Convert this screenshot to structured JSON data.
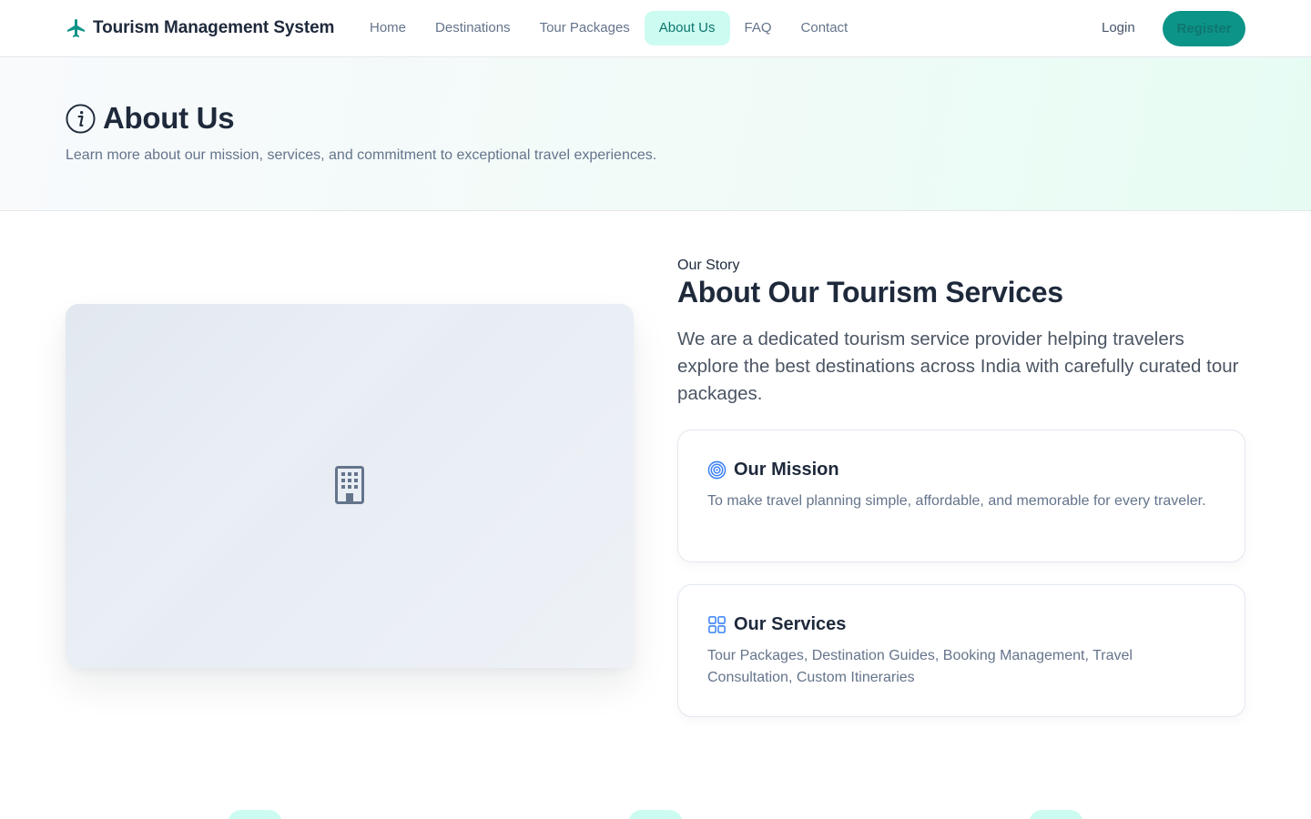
{
  "nav": {
    "brand": "Tourism Management System",
    "brand_icon": "airplane-icon",
    "links": [
      "Home",
      "Destinations",
      "Tour Packages",
      "About Us",
      "FAQ",
      "Contact"
    ],
    "active_link": "About Us",
    "login": "Login",
    "register": "Register"
  },
  "hero": {
    "icon": "info-icon",
    "title": "About Us",
    "subtitle": "Learn more about our mission, services, and commitment to exceptional travel experiences."
  },
  "image": {
    "icon": "building-icon"
  },
  "story": {
    "eyebrow": "Our Story",
    "heading": "About Our Tourism Services",
    "text": "We are a dedicated tourism service provider helping travelers explore the best destinations across India with carefully curated tour packages."
  },
  "cards": [
    {
      "icon": "target-icon",
      "title": "Our Mission",
      "text": "To make travel planning simple, affordable, and memorable for every traveler."
    },
    {
      "icon": "grid-icon",
      "title": "Our Services",
      "text": "Tour Packages, Destination Guides, Booking Management, Travel Consultation, Custom Itineraries"
    }
  ],
  "colors": {
    "primary": "#0d9488",
    "active_bg": "#ccfbf1",
    "active_text": "#0f766e",
    "heading": "#1e293b",
    "muted": "#64748b",
    "icon_blue": "#3b82f6"
  }
}
